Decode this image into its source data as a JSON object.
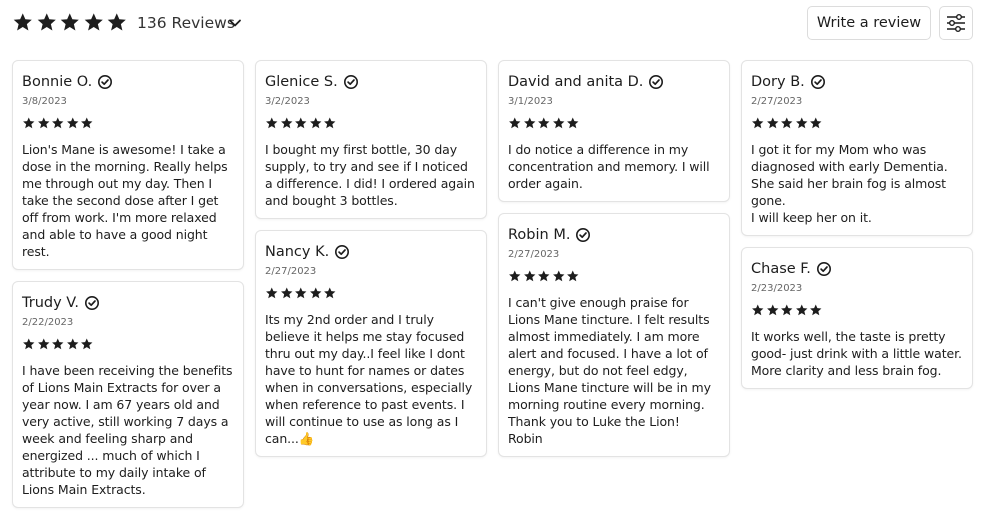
{
  "summary": {
    "rating_stars": 5,
    "reviews_label": "136 Reviews"
  },
  "toolbar": {
    "write_review_label": "Write a review",
    "filter_icon": "sliders-icon"
  },
  "colors": {
    "star": "#1d1d1d",
    "card_border": "#e3e3e3",
    "verified_badge": "#1d1d1d"
  },
  "columns": [
    [
      {
        "name": "Bonnie O.",
        "date": "3/8/2023",
        "rating": 5,
        "text": "Lion's Mane is awesome! I take a dose in the morning. Really helps me through out my day. Then I take the second dose after I get off from work. I'm more relaxed and able to have a good night rest."
      },
      {
        "name": "Trudy V.",
        "date": "2/22/2023",
        "rating": 5,
        "text": "I have been receiving the benefits of Lions Main Extracts for over a year now. I am 67 years old and very active, still working 7 days a week and feeling sharp and energized ... much of which I attribute to my daily intake of Lions Main Extracts."
      }
    ],
    [
      {
        "name": "Glenice S.",
        "date": "3/2/2023",
        "rating": 5,
        "text": "I bought my first bottle, 30 day supply, to try and see if I noticed a difference. I did! I ordered again and bought 3 bottles."
      },
      {
        "name": "Nancy K.",
        "date": "2/27/2023",
        "rating": 5,
        "text": "Its my 2nd order and I truly believe it helps me stay focused thru out my day..I feel like I dont have to hunt for names or dates when in conversations, especially when reference to past events. I will continue to use as long as I can...👍"
      }
    ],
    [
      {
        "name": "David and anita D.",
        "date": "3/1/2023",
        "rating": 5,
        "text": "I do notice a difference in my concentration and memory. I will order again."
      },
      {
        "name": "Robin M.",
        "date": "2/27/2023",
        "rating": 5,
        "text": "I can't give enough praise for Lions Mane tincture. I felt results almost immediately. I am more alert and focused. I have a lot of energy, but do not feel edgy, Lions Mane tincture will be in my morning routine every morning.\nThank you to Luke the Lion!\nRobin"
      }
    ],
    [
      {
        "name": "Dory B.",
        "date": "2/27/2023",
        "rating": 5,
        "text": "I got it for my Mom who was diagnosed with early Dementia. She said her brain fog is almost gone.\nI will keep her on it."
      },
      {
        "name": "Chase F.",
        "date": "2/23/2023",
        "rating": 5,
        "text": "It works well, the taste is pretty good- just drink with a little water. More clarity and less brain fog."
      }
    ]
  ]
}
